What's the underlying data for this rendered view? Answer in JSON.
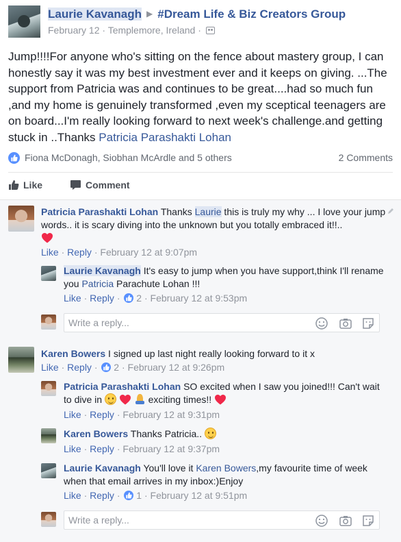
{
  "post": {
    "author": "Laurie Kavanagh",
    "group": "#Dream Life & Biz Creators Group",
    "date": "February 12",
    "location": "Templemore, Ireland",
    "body_text": "Jump!!!!For anyone who's sitting on the fence about mastery group, I can honestly say it was my best investment ever and it keeps on giving. ...The support from Patricia was and continues to be great....had so much fun ,and my home is genuinely transformed ,even my sceptical teenagers are on board...I'm really looking forward to next week's challenge.and getting stuck in ..Thanks ",
    "body_mention": "Patricia Parashakti Lohan"
  },
  "reactions": {
    "names": "Fiona McDonagh, Siobhan McArdle and 5 others",
    "comment_count": "2 Comments"
  },
  "actions": {
    "like": "Like",
    "comment": "Comment"
  },
  "meta_labels": {
    "like": "Like",
    "reply": "Reply",
    "sep": " · "
  },
  "comments": [
    {
      "author": "Patricia Parashakti Lohan",
      "text_a": " Thanks ",
      "tag": "Laurie",
      "text_b": " this is truly my why ... I love your jump words.. it is scary diving into the unknown but you totally embraced it!!..",
      "time": "February 12 at 9:07pm",
      "replies": [
        {
          "author": "Laurie Kavanagh",
          "text_a": " It's easy to jump when you have support,think I'll rename you ",
          "mention": "Patricia",
          "text_b": " Parachute Lohan !!!",
          "like_count": "2",
          "time": "February 12 at 9:53pm"
        }
      ]
    },
    {
      "author": "Karen Bowers",
      "text": " I signed up last night really looking forward to it x",
      "like_count": "2",
      "time": "February 12 at 9:26pm",
      "replies": [
        {
          "author": "Patricia Parashakti Lohan",
          "text_a": " SO excited when I saw you joined!!! Can't wait to dive in ",
          "text_b": " exciting times!! ",
          "time": "February 12 at 9:31pm"
        },
        {
          "author": "Karen Bowers",
          "text": " Thanks Patricia.. ",
          "time": "February 12 at 9:37pm"
        },
        {
          "author": "Laurie Kavanagh",
          "text_a": " You'll love it ",
          "mention": "Karen Bowers",
          "text_b": ",my favourite time of week when that email arrives in my inbox:)Enjoy",
          "like_count": "1",
          "time": "February 12 at 9:51pm"
        }
      ]
    }
  ],
  "reply_box": {
    "placeholder": "Write a reply..."
  },
  "icons": {
    "audience": "group-audience-icon",
    "like_badge": "like-reaction-icon",
    "heart": "heart-emoji",
    "emoji": "emoji-icon",
    "camera": "camera-icon",
    "sticker": "sticker-icon",
    "edit": "pencil-icon"
  },
  "colors": {
    "link": "#365899",
    "action_link": "#4267b2",
    "like_blue": "#5890ff",
    "muted": "#90949c",
    "heart": "#f0284a"
  }
}
